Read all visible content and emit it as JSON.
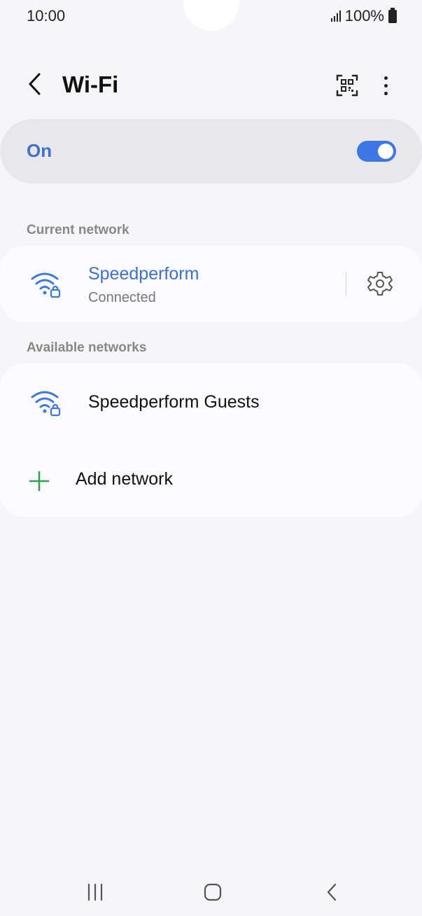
{
  "status_bar": {
    "time": "10:00",
    "battery": "100%"
  },
  "header": {
    "title": "Wi-Fi"
  },
  "wifi_toggle": {
    "label": "On",
    "state": "on"
  },
  "current_network": {
    "section_label": "Current network",
    "name": "Speedperform",
    "status": "Connected"
  },
  "available_networks": {
    "section_label": "Available networks",
    "items": [
      {
        "name": "Speedperform Guests"
      }
    ],
    "add_label": "Add network"
  },
  "colors": {
    "accent": "#3e76e3",
    "accent_text": "#3e6fd3",
    "add_icon": "#2ea04f",
    "background": "#f6f6f8"
  }
}
